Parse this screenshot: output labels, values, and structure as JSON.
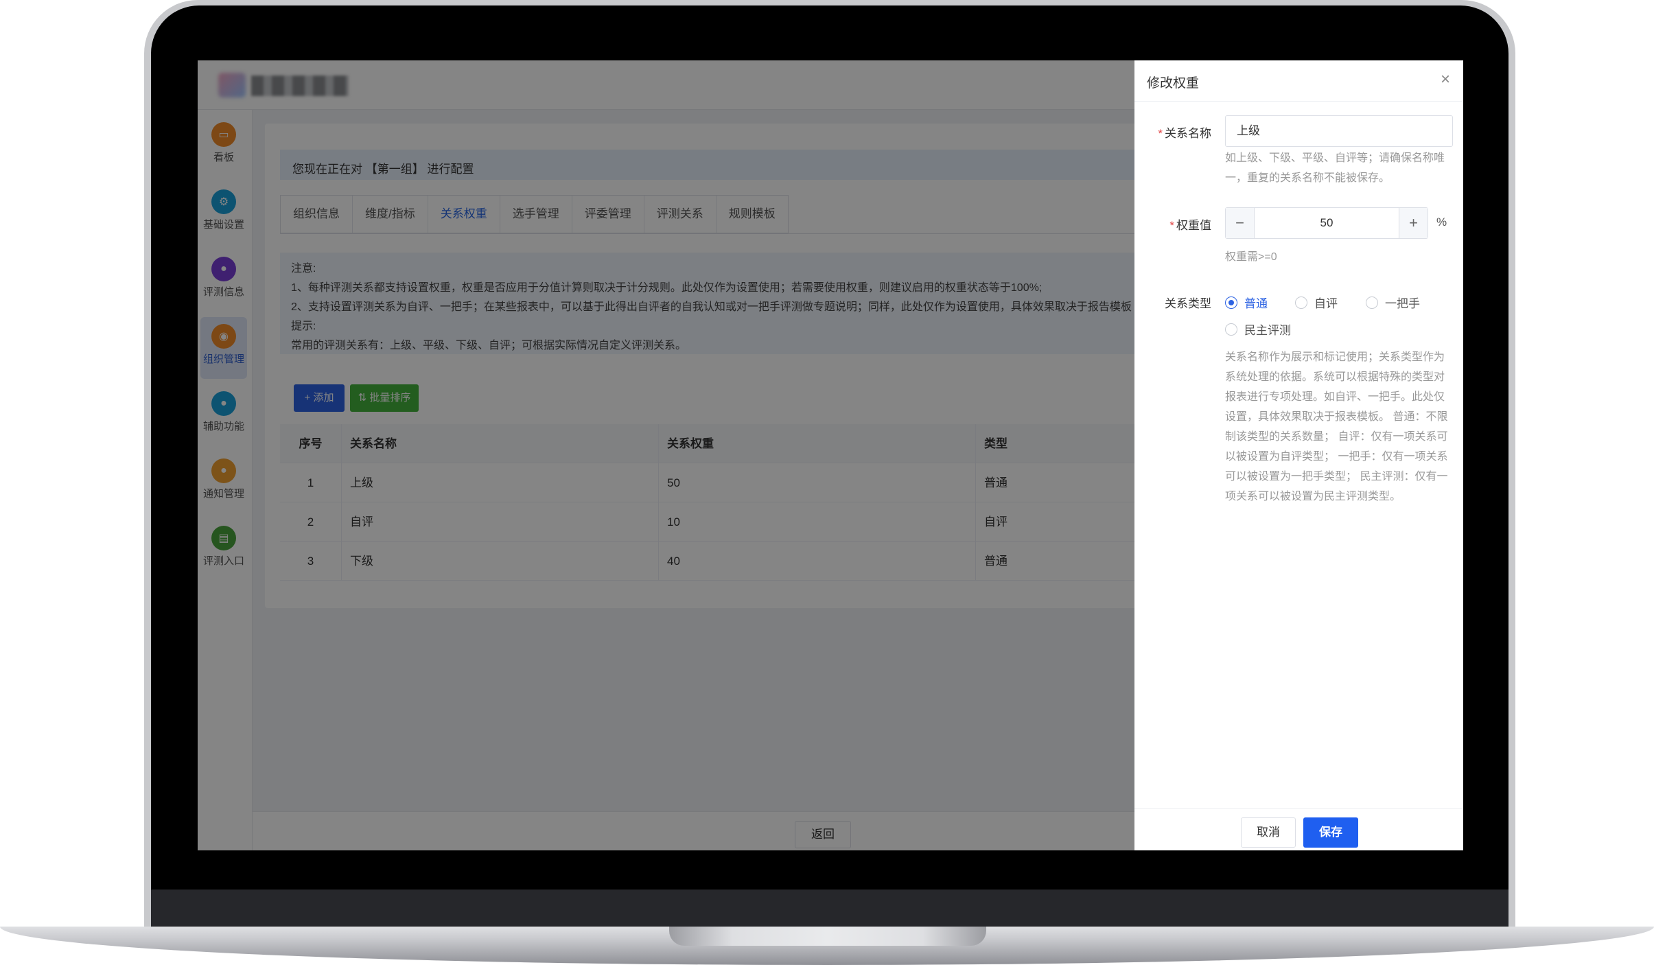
{
  "sidebar": {
    "items": [
      {
        "label": "看板",
        "color": "#f08b2a"
      },
      {
        "label": "基础设置",
        "color": "#1aa0d8"
      },
      {
        "label": "评测信息",
        "color": "#7a3fd6"
      },
      {
        "label": "组织管理",
        "color": "#f08b2a"
      },
      {
        "label": "辅助功能",
        "color": "#1aa0d8"
      },
      {
        "label": "通知管理",
        "color": "#f0a030"
      },
      {
        "label": "评测入口",
        "color": "#4aa33d"
      }
    ]
  },
  "notice": "您现在正在对 【第一组】 进行配置",
  "tabs": [
    "组织信息",
    "维度/指标",
    "关系权重",
    "选手管理",
    "评委管理",
    "评测关系",
    "规则模板"
  ],
  "note_lines": [
    "注意:",
    "1、每种评测关系都支持设置权重，权重是否应用于分值计算则取决于计分规则。此处仅作为设置使用；若需要使用权重，则建议启用的权重状态等于100%;",
    "2、支持设置评测关系为自评、一把手；在某些报表中，可以基于此得出自评者的自我认知或对一把手评测做专题说明；同样，此处仅作为设置使用，具体效果取决于报告模板",
    "提示:",
    "常用的评测关系有：上级、平级、下级、自评；可根据实际情况自定义评测关系。"
  ],
  "buttons": {
    "add": "+ 添加",
    "sort": "⇅ 批量排序",
    "back": "返回"
  },
  "table": {
    "headers": [
      "序号",
      "关系名称",
      "关系权重",
      "类型"
    ],
    "rows": [
      [
        "1",
        "上级",
        "50",
        "普通"
      ],
      [
        "2",
        "自评",
        "10",
        "自评"
      ],
      [
        "3",
        "下级",
        "40",
        "普通"
      ]
    ]
  },
  "drawer": {
    "title": "修改权重",
    "close": "×",
    "name_label": "关系名称",
    "name_value": "上级",
    "name_help_1": "如上级、下级、平级、自评等；请确保名称唯",
    "name_help_2": "一，重复的关系名称不能被保存。",
    "weight_label": "权重值",
    "weight_value": "50",
    "minus": "−",
    "plus": "+",
    "percent": "%",
    "weight_help": "权重需>=0",
    "type_label": "关系类型",
    "type_options": [
      "普通",
      "自评",
      "一把手",
      "民主评测"
    ],
    "type_selected": "普通",
    "type_help": [
      "关系名称作为展示和标记使用；关系类型作为",
      "系统处理的依据。系统可以根据特殊的类型对",
      "报表进行专项处理。如自评、一把手。此处仅",
      "设置，具体效果取决于报表模板。 普通：不限",
      "制该类型的关系数量； 自评：仅有一项关系可",
      "以被设置为自评类型； 一把手：仅有一项关系",
      "可以被设置为一把手类型； 民主评测：仅有一",
      "项关系可以被设置为民主评测类型。"
    ],
    "cancel": "取消",
    "save": "保存"
  }
}
